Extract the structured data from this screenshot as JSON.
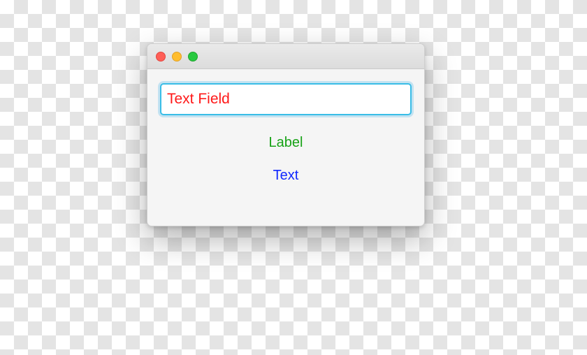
{
  "window": {
    "input_value": "Text Field",
    "input_color": "#ff1818",
    "label_text": "Label",
    "label_color": "#17a216",
    "text_text": "Text",
    "text_color": "#1129ff"
  },
  "traffic_lights": {
    "close_color": "#ff5f57",
    "minimize_color": "#ffbd2e",
    "zoom_color": "#28c940"
  }
}
